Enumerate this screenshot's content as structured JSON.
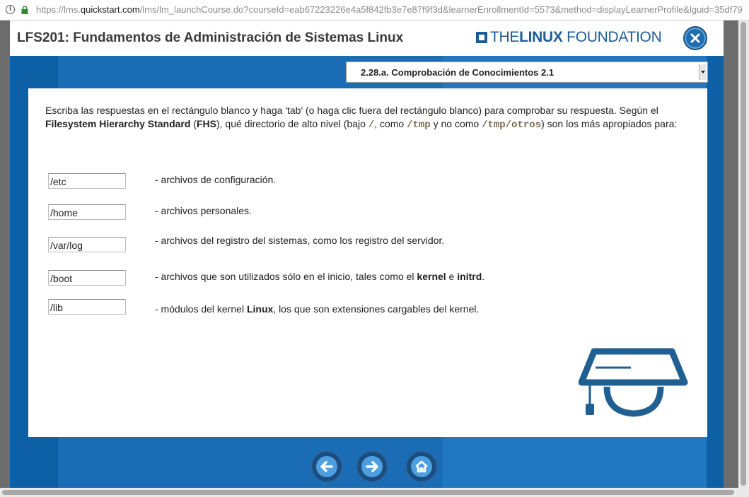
{
  "browser": {
    "url_prefix": "https://lms.",
    "url_host": "quickstart.com",
    "url_path": "/lms/lm_launchCourse.do?courseId=eab67223226e4a5f842fb3e7e87f9f3d&learnerEnrollmentId=5573&method=displayLearnerProfile&lguid=35df79"
  },
  "header": {
    "course_title": "LFS201: Fundamentos de Administración de Sistemas Linux",
    "logo_the": "THE",
    "logo_linux": "LINUX",
    "logo_foundation": "FOUNDATION"
  },
  "section_select": {
    "selected": "2.28.a. Comprobación de Conocimientos 2.1"
  },
  "intro": {
    "p1": "Escriba las respuestas en el rectángulo blanco y haga 'tab' (o haga clic fuera del rectángulo blanco) para comprobar su respuesta. Según el ",
    "fhs_full": "Filesystem Hierarchy Standard",
    "p2": " (",
    "fhs_abbr": "FHS",
    "p3": "), qué directorio de alto nivel (bajo ",
    "root": "/",
    "p4": ", como ",
    "tmp": "/tmp",
    "p5": " y no como ",
    "tmp_otros": "/tmp/otros",
    "p6": ") son los más apropiados para:"
  },
  "questions": [
    {
      "answer": "/etc",
      "desc": "- archivos de configuración."
    },
    {
      "answer": "/home",
      "desc": "- archivos personales."
    },
    {
      "answer": "/var/log",
      "desc": "- archivos del registro del sistemas, como los registro del servidor."
    },
    {
      "answer": "/boot",
      "desc_a": "- archivos que son utilizados sólo en el inicio, tales como el ",
      "desc_b": "kernel",
      "desc_c": " e ",
      "desc_d": "initrd",
      "desc_e": "."
    },
    {
      "answer": "/lib",
      "desc_a": "- módulos del kernel ",
      "desc_b": "Linux",
      "desc_c": ", los que son extensiones cargables  del kernel."
    }
  ],
  "nav": {
    "back_icon": "arrow-left-icon",
    "next_icon": "arrow-right-icon",
    "home_icon": "home-icon"
  },
  "colors": {
    "brand_blue": "#1d5d97",
    "band_blue": "#1f78c1",
    "code_color": "#7a6b4f"
  }
}
